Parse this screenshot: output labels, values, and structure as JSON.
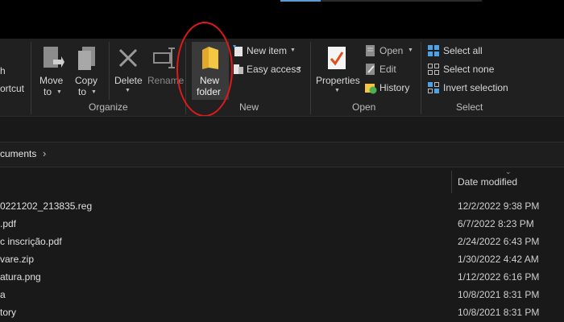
{
  "ribbon": {
    "partial_left_top": "h",
    "partial_left_bottom": "ortcut",
    "organize": {
      "group_label": "Organize",
      "move_to": [
        "Move",
        "to"
      ],
      "copy_to": [
        "Copy",
        "to"
      ],
      "delete": "Delete",
      "rename": "Rename"
    },
    "new": {
      "group_label": "New",
      "new_folder": [
        "New",
        "folder"
      ],
      "new_item": "New item",
      "easy_access": "Easy access"
    },
    "open": {
      "group_label": "Open",
      "properties": "Properties",
      "open": "Open",
      "edit": "Edit",
      "history": "History"
    },
    "select": {
      "group_label": "Select",
      "select_all": "Select all",
      "select_none": "Select none",
      "invert_selection": "Invert selection"
    }
  },
  "address": {
    "crumb": "cuments",
    "separator": "›"
  },
  "columns": {
    "date_modified": "Date modified"
  },
  "files": [
    {
      "name": "0221202_213835.reg",
      "date": "12/2/2022 9:38 PM"
    },
    {
      "name": ".pdf",
      "date": "6/7/2022 8:23 PM"
    },
    {
      "name": "c inscrição.pdf",
      "date": "2/24/2022 6:43 PM"
    },
    {
      "name": "vare.zip",
      "date": "1/30/2022 4:42 AM"
    },
    {
      "name": "atura.png",
      "date": "1/12/2022 6:16 PM"
    },
    {
      "name": "a",
      "date": "10/8/2021 8:31 PM"
    },
    {
      "name": "tory",
      "date": "10/8/2021 8:31 PM"
    }
  ],
  "colors": {
    "annotation": "#e01919",
    "accent": "#4aa3e8",
    "folder": "#f3c744"
  }
}
